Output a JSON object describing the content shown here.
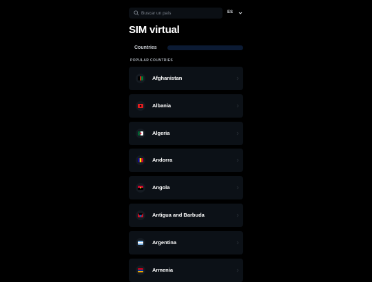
{
  "search": {
    "placeholder": "Buscar un país",
    "language": "ES"
  },
  "page_title": "SIM virtual",
  "tabs": [
    {
      "label": "Countries",
      "active": true
    }
  ],
  "section_title": "POPULAR COUNTRIES",
  "countries": [
    {
      "name": "Afghanistan",
      "flag": "flag-af"
    },
    {
      "name": "Albania",
      "flag": "flag-al"
    },
    {
      "name": "Algeria",
      "flag": "flag-dz"
    },
    {
      "name": "Andorra",
      "flag": "flag-ad"
    },
    {
      "name": "Angola",
      "flag": "flag-ao"
    },
    {
      "name": "Antigua and Barbuda",
      "flag": "flag-ag"
    },
    {
      "name": "Argentina",
      "flag": "flag-ar"
    },
    {
      "name": "Armenia",
      "flag": "flag-am"
    }
  ],
  "colors": {
    "background": "#000000",
    "card": "#0c1117",
    "tab_bar": "#0b1a33",
    "text": "#ffffff"
  }
}
